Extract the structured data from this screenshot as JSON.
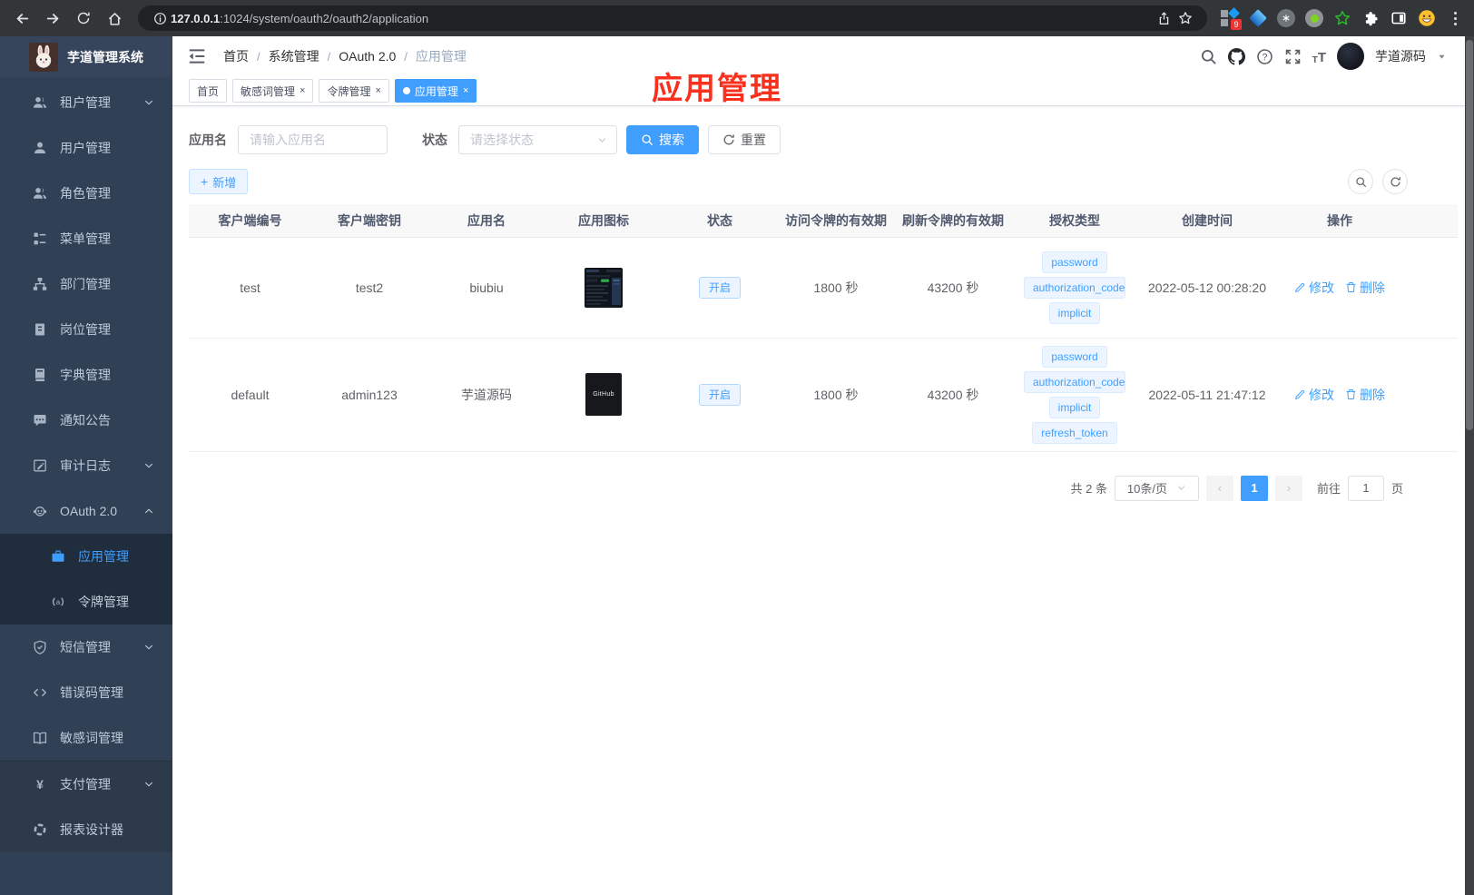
{
  "colors": {
    "accent": "#409eff",
    "sidebar_bg": "#304156",
    "submenu_bg": "#1f2d3d",
    "annotation_red": "#f8311f",
    "tag_bg": "#ecf5ff",
    "browser_bar_bg": "#323639"
  },
  "icons": {
    "search": "magnifier",
    "github": "octocat",
    "help": "question-circle",
    "fullscreen": "expand-arrows",
    "font_size": "TT",
    "refresh": "circular-arrow",
    "add": "+",
    "edit": "pencil",
    "delete": "trash",
    "close": "×",
    "dropdown": "chevron-down"
  },
  "browser": {
    "url_host": "127.0.0.1",
    "url_path": ":1024/system/oauth2/oauth2/application",
    "extension_badge": "9"
  },
  "sidebar": {
    "app_title": "芋道管理系统",
    "menu": [
      {
        "label": "租户管理"
      },
      {
        "label": "用户管理"
      },
      {
        "label": "角色管理"
      },
      {
        "label": "菜单管理"
      },
      {
        "label": "部门管理"
      },
      {
        "label": "岗位管理"
      },
      {
        "label": "字典管理"
      },
      {
        "label": "通知公告"
      },
      {
        "label": "审计日志"
      },
      {
        "label": "OAuth 2.0"
      },
      {
        "label": "应用管理"
      },
      {
        "label": "令牌管理"
      },
      {
        "label": "短信管理"
      },
      {
        "label": "错误码管理"
      },
      {
        "label": "敏感词管理"
      },
      {
        "label": "支付管理"
      },
      {
        "label": "报表设计器"
      }
    ]
  },
  "navbar": {
    "breadcrumb": [
      "首页",
      "系统管理",
      "OAuth 2.0",
      "应用管理"
    ],
    "username": "芋道源码"
  },
  "tags_view": [
    {
      "label": "首页"
    },
    {
      "label": "敏感词管理"
    },
    {
      "label": "令牌管理"
    },
    {
      "label": "应用管理"
    }
  ],
  "annotation": "应用管理",
  "filter": {
    "name_label": "应用名",
    "name_placeholder": "请输入应用名",
    "status_label": "状态",
    "status_placeholder": "请选择状态",
    "search_label": "搜索",
    "reset_label": "重置"
  },
  "toolbar": {
    "add_label": "新增"
  },
  "table": {
    "headers": [
      "客户端编号",
      "客户端密钥",
      "应用名",
      "应用图标",
      "状态",
      "访问令牌的有效期",
      "刷新令牌的有效期",
      "授权类型",
      "创建时间",
      "操作"
    ],
    "rows": [
      {
        "client_id": "test",
        "client_secret": "test2",
        "app_name": "biubiu",
        "status": "开启",
        "access_ttl": "1800 秒",
        "refresh_ttl": "43200 秒",
        "grant_types": [
          "password",
          "authorization_code",
          "implicit"
        ],
        "created_at": "2022-05-12 00:28:20",
        "edit_label": "修改",
        "delete_label": "删除"
      },
      {
        "client_id": "default",
        "client_secret": "admin123",
        "app_name": "芋道源码",
        "icon_label": "GitHub",
        "status": "开启",
        "access_ttl": "1800 秒",
        "refresh_ttl": "43200 秒",
        "grant_types": [
          "password",
          "authorization_code",
          "implicit",
          "refresh_token"
        ],
        "created_at": "2022-05-11 21:47:12",
        "edit_label": "修改",
        "delete_label": "删除"
      }
    ]
  },
  "pagination": {
    "total": "共 2 条",
    "page_size": "10条/页",
    "current_page": "1",
    "goto_label": "前往",
    "goto_value": "1",
    "unit_label": "页"
  }
}
